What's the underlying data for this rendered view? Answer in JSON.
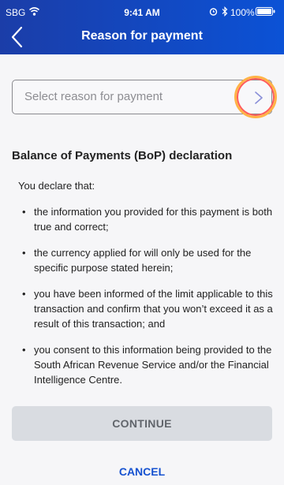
{
  "status_bar": {
    "carrier": "SBG",
    "time": "9:41 AM",
    "battery": "100%",
    "icons": [
      "wifi-icon",
      "alarm-icon",
      "bluetooth-icon",
      "battery-icon"
    ]
  },
  "header": {
    "title": "Reason for payment",
    "back_icon": "chevron-left-icon",
    "colors": {
      "start": "#1b3da8",
      "end": "#0b52d6"
    }
  },
  "reason_select": {
    "placeholder": "Select reason for payment",
    "icon": "chevron-right-icon"
  },
  "declaration": {
    "heading": "Balance of Payments (BoP) declaration",
    "intro": "You declare that:",
    "items": [
      "the information you provided for this payment is both true and correct;",
      "the currency applied for will only be used for the specific purpose stated herein;",
      "you have been informed of the limit applicable to this transaction and confirm that you won’t exceed it as a result of this transaction; and",
      "you consent to this information being provided to the South African Revenue Service and/or the Financial Intelligence Centre."
    ]
  },
  "actions": {
    "continue_label": "CONTINUE",
    "cancel_label": "CANCEL",
    "accent_color": "#1652d0"
  }
}
